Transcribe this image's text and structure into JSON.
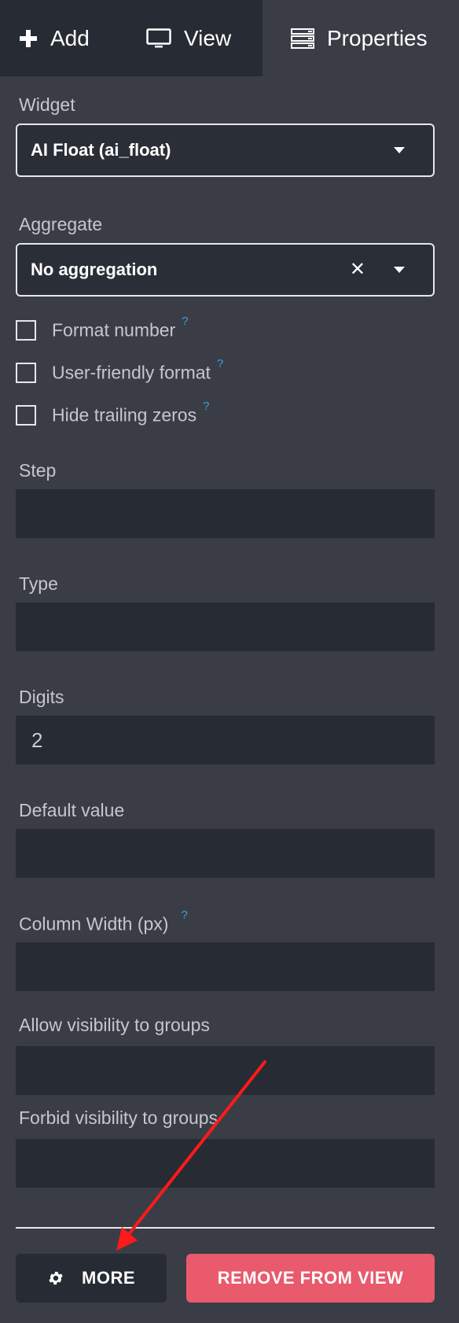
{
  "tabs": {
    "add": {
      "label": "Add",
      "icon": "plus-icon"
    },
    "view": {
      "label": "View",
      "icon": "monitor-icon"
    },
    "properties": {
      "label": "Properties",
      "icon": "list-icon",
      "active": true
    }
  },
  "widget": {
    "label": "Widget",
    "value": "AI Float (ai_float)"
  },
  "aggregate": {
    "label": "Aggregate",
    "value": "No aggregation"
  },
  "checkboxes": [
    {
      "label": "Format number",
      "help": "?",
      "checked": false
    },
    {
      "label": "User-friendly format",
      "help": "?",
      "checked": false
    },
    {
      "label": "Hide trailing zeros",
      "help": "?",
      "checked": false
    }
  ],
  "fields": {
    "step": {
      "label": "Step",
      "value": ""
    },
    "type": {
      "label": "Type",
      "value": ""
    },
    "digits": {
      "label": "Digits",
      "value": "2"
    },
    "default_value": {
      "label": "Default value",
      "value": ""
    },
    "column_width": {
      "label": "Column Width (px)",
      "help": "?",
      "value": ""
    },
    "allow_groups": {
      "label": "Allow visibility to groups",
      "value": ""
    },
    "forbid_groups": {
      "label": "Forbid visibility to groups",
      "value": ""
    }
  },
  "buttons": {
    "more": {
      "label": "MORE",
      "icon": "gear-icon"
    },
    "remove": {
      "label": "REMOVE FROM VIEW"
    }
  },
  "colors": {
    "background": "#3a3d45",
    "tab_bar": "#272b33",
    "input_bg": "#272b33",
    "remove_button": "#e85a6c",
    "help": "#3aa0d8",
    "annotation_arrow": "#ff1a1a"
  }
}
